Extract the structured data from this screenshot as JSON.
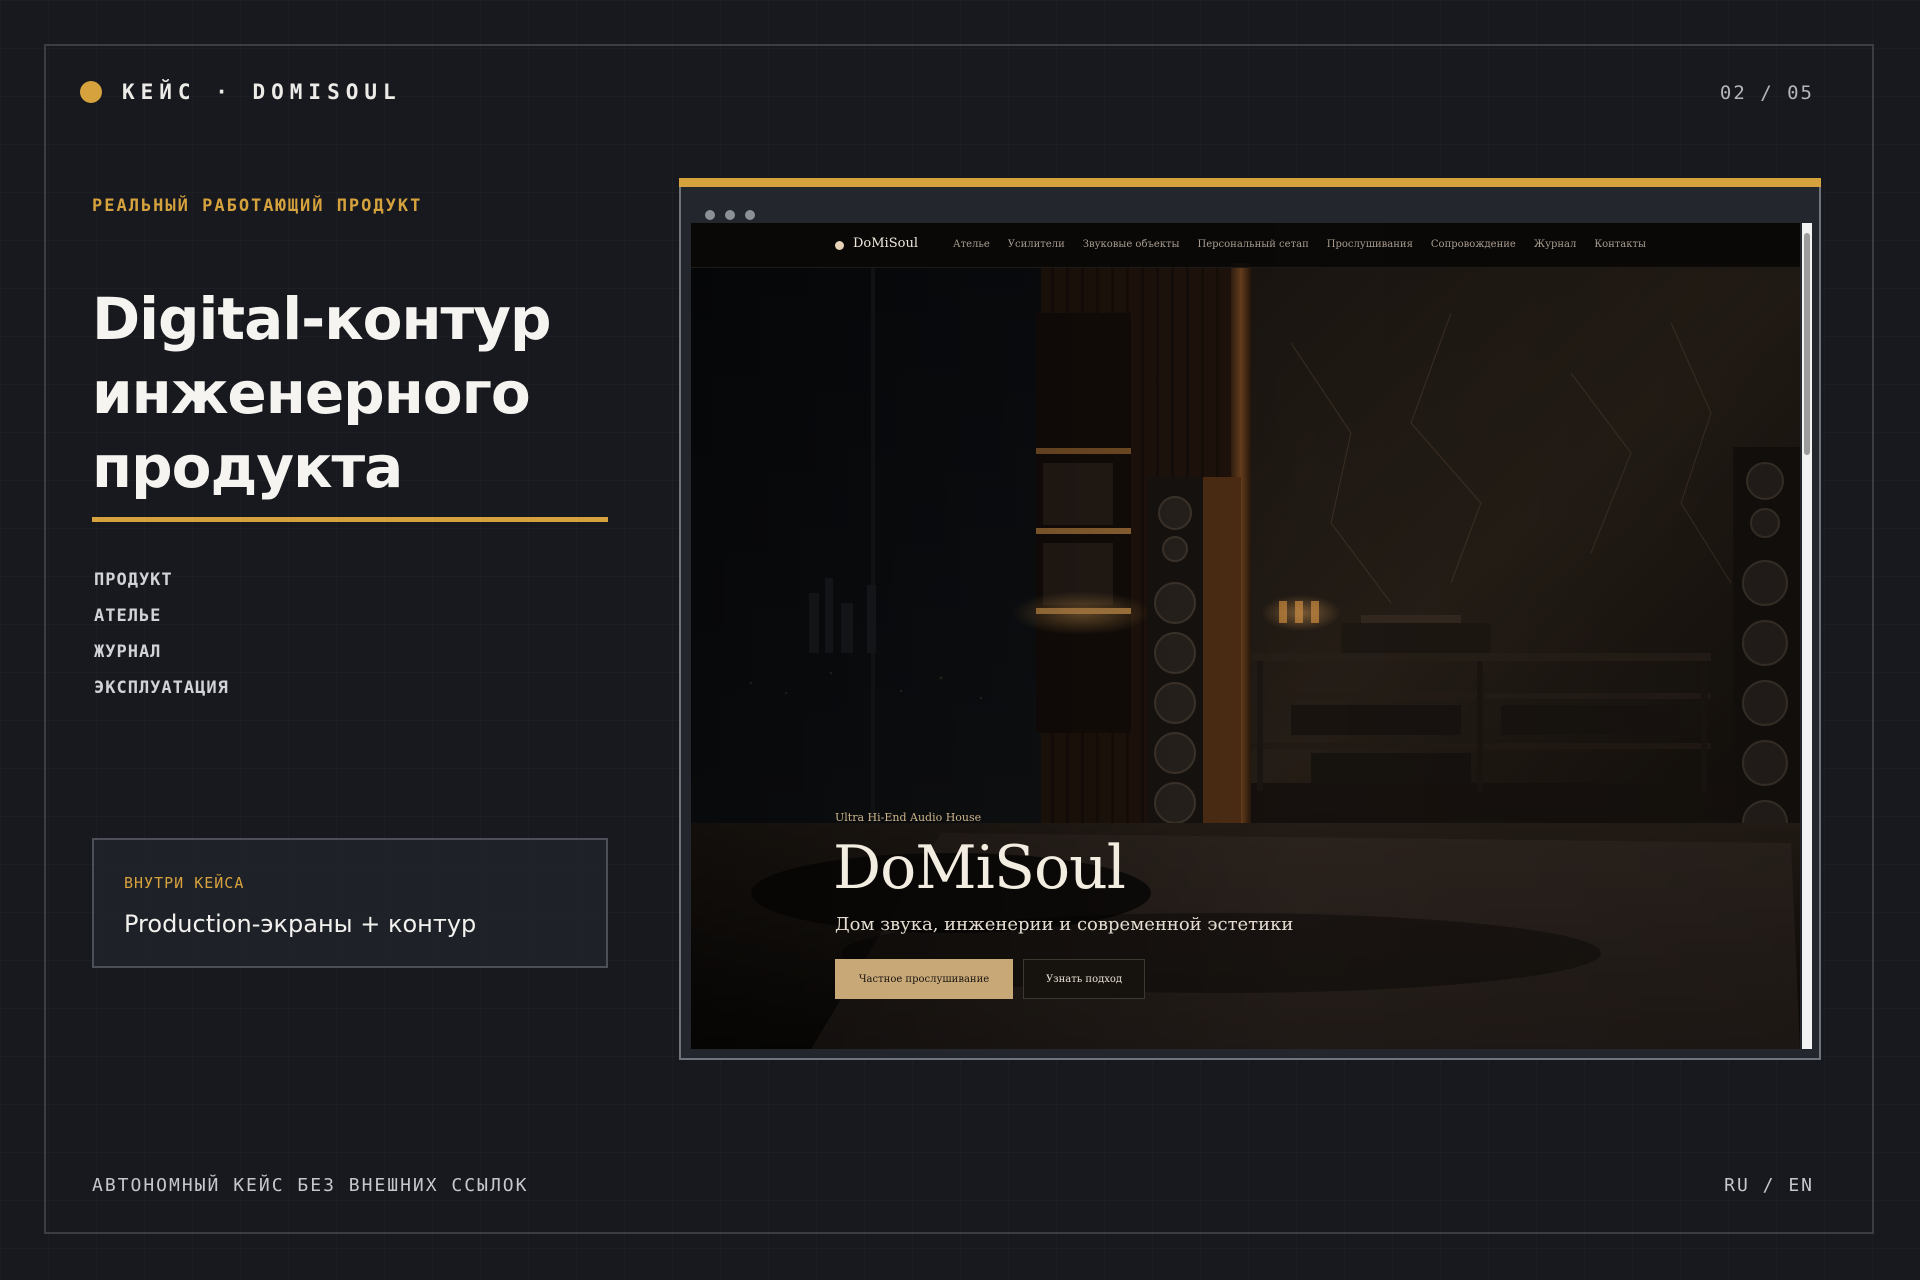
{
  "header": {
    "case_label": "КЕЙС · DOMISOUL",
    "page_counter": "02 / 05"
  },
  "left": {
    "eyebrow": "РЕАЛЬНЫЙ РАБОТАЮЩИЙ ПРОДУКТ",
    "headline_lines": [
      "Digital-контур",
      "инженерного",
      "продукта"
    ],
    "nav": [
      "ПРОДУКТ",
      "АТЕЛЬЕ",
      "ЖУРНАЛ",
      "ЭКСПЛУАТАЦИЯ"
    ],
    "inside_box": {
      "label": "ВНУТРИ КЕЙСА",
      "text": "Production-экраны + контур"
    }
  },
  "footer": {
    "left": "АВТОНОМНЫЙ КЕЙС БЕЗ ВНЕШНИХ ССЫЛОК",
    "right": "RU / EN"
  },
  "website": {
    "logo": "DoMiSoul",
    "nav_links": [
      "Ателье",
      "Усилители",
      "Звуковые объекты",
      "Персональный сетап",
      "Прослушивания",
      "Сопровождение",
      "Журнал",
      "Контакты"
    ],
    "hero": {
      "eyebrow": "Ultra Hi-End Audio House",
      "title": "DoMiSoul",
      "subtitle": "Дом звука, инженерии и современной эстетики",
      "primary_button": "Частное прослушивание",
      "secondary_button": "Узнать подход"
    }
  },
  "colors": {
    "accent": "#d6a23d",
    "background": "#17191e",
    "site_button": "#c8a877"
  }
}
